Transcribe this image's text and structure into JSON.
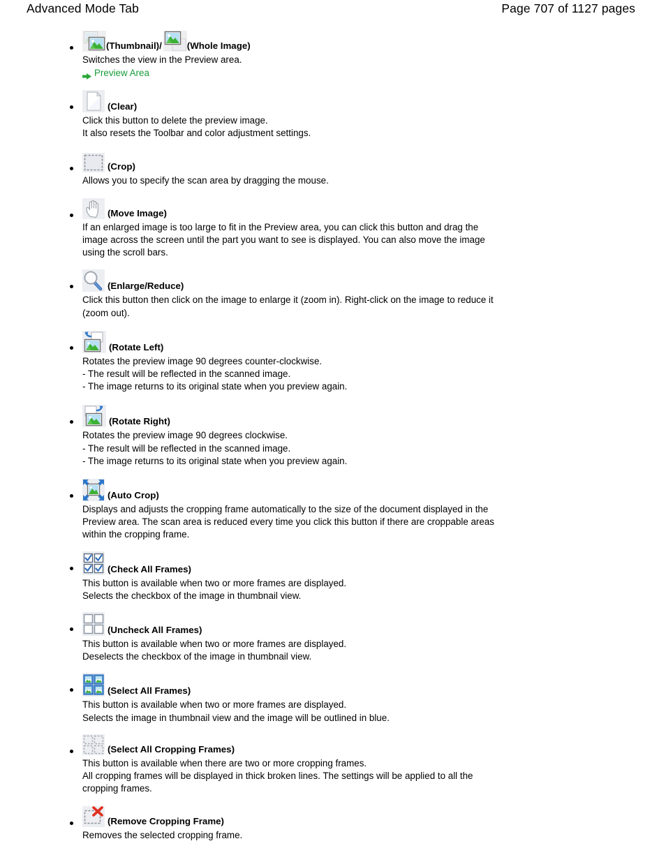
{
  "header": {
    "left_title": "Advanced Mode Tab",
    "right_title": "Page 707 of 1127 pages"
  },
  "colors": {
    "link_green": "#1a9c3c",
    "icon_blue": "#4a7ebb",
    "icon_red": "#e03020",
    "image_green": "#3cb034",
    "image_sky": "#a8d8f0"
  },
  "items": [
    {
      "id": "thumbnail-whole-image",
      "icon1": "thumbnail-icon",
      "label1": "(Thumbnail)",
      "separator": "/",
      "icon2": "whole-image-icon",
      "label2": "(Whole Image)",
      "desc": "Switches the view in the Preview area.",
      "link": "Preview Area"
    },
    {
      "id": "clear",
      "icon1": "clear-page-icon",
      "label1": "(Clear)",
      "desc": "Click this button to delete the preview image.\nIt also resets the Toolbar and color adjustment settings."
    },
    {
      "id": "crop",
      "icon1": "crop-icon",
      "label1": "(Crop)",
      "desc": "Allows you to specify the scan area by dragging the mouse."
    },
    {
      "id": "move-image",
      "icon1": "hand-move-icon",
      "label1": "(Move Image)",
      "desc": "If an enlarged image is too large to fit in the Preview area, you can click this button and drag the image across the screen until the part you want to see is displayed. You can also move the image using the scroll bars."
    },
    {
      "id": "enlarge-reduce",
      "icon1": "magnifier-icon",
      "label1": "(Enlarge/Reduce)",
      "desc": "Click this button then click on the image to enlarge it (zoom in). Right-click on the image to reduce it (zoom out)."
    },
    {
      "id": "rotate-left",
      "icon1": "rotate-left-icon",
      "label1": "(Rotate Left)",
      "desc": "Rotates the preview image 90 degrees counter-clockwise.\n- The result will be reflected in the scanned image.\n- The image returns to its original state when you preview again."
    },
    {
      "id": "rotate-right",
      "icon1": "rotate-right-icon",
      "label1": "(Rotate Right)",
      "desc": "Rotates the preview image 90 degrees clockwise.\n- The result will be reflected in the scanned image.\n- The image returns to its original state when you preview again."
    },
    {
      "id": "auto-crop",
      "icon1": "auto-crop-icon",
      "label1": "(Auto Crop)",
      "desc": "Displays and adjusts the cropping frame automatically to the size of the document displayed in the Preview area. The scan area is reduced every time you click this button if there are croppable areas within the cropping frame."
    },
    {
      "id": "check-all-frames",
      "icon1": "check-all-frames-icon",
      "label1": "(Check All Frames)",
      "desc": "This button is available when two or more frames are displayed.\nSelects the checkbox of the image in thumbnail view."
    },
    {
      "id": "uncheck-all-frames",
      "icon1": "uncheck-all-frames-icon",
      "label1": "(Uncheck All Frames)",
      "desc": "This button is available when two or more frames are displayed.\nDeselects the checkbox of the image in thumbnail view."
    },
    {
      "id": "select-all-frames",
      "icon1": "select-all-frames-icon",
      "label1": "(Select All Frames)",
      "desc": "This button is available when two or more frames are displayed.\nSelects the image in thumbnail view and the image will be outlined in blue."
    },
    {
      "id": "select-all-cropping-frames",
      "icon1": "select-all-cropping-frames-icon",
      "label1": "(Select All Cropping Frames)",
      "desc": "This button is available when there are two or more cropping frames.\nAll cropping frames will be displayed in thick broken lines. The settings will be applied to all the cropping frames."
    },
    {
      "id": "remove-cropping-frame",
      "icon1": "remove-cropping-frame-icon",
      "label1": "(Remove Cropping Frame)",
      "desc": "Removes the selected cropping frame."
    }
  ]
}
